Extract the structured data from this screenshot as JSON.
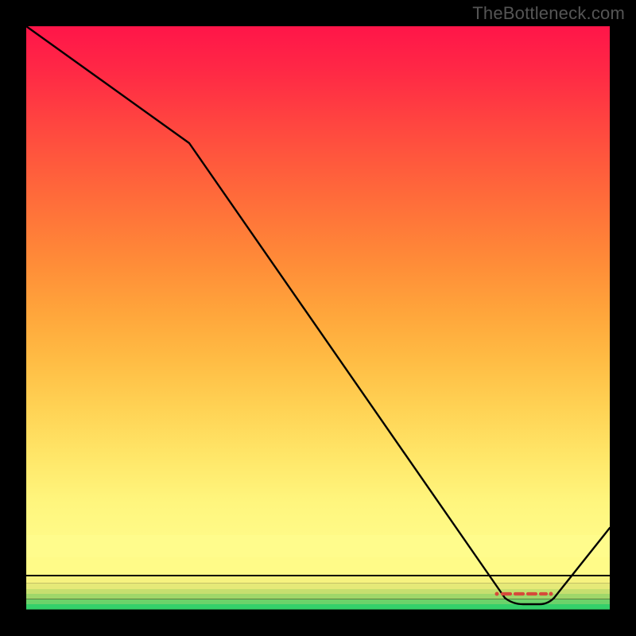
{
  "watermark": "TheBottleneck.com",
  "chart_data": {
    "type": "line",
    "title": "",
    "xlabel": "",
    "ylabel": "",
    "xlim": [
      0,
      100
    ],
    "ylim": [
      0,
      100
    ],
    "series": [
      {
        "name": "curve",
        "x": [
          0,
          28,
          82,
          88,
          100
        ],
        "y": [
          100,
          80,
          2,
          2,
          14
        ]
      }
    ],
    "marker_band": {
      "x_start": 80.5,
      "x_end": 90,
      "y": 2.6
    },
    "grid": false,
    "legend": false
  },
  "colors": {
    "curve": "#000000",
    "marker": "#d64a3a",
    "background_top": "#ff1549",
    "background_bottom": "#34d06a"
  }
}
